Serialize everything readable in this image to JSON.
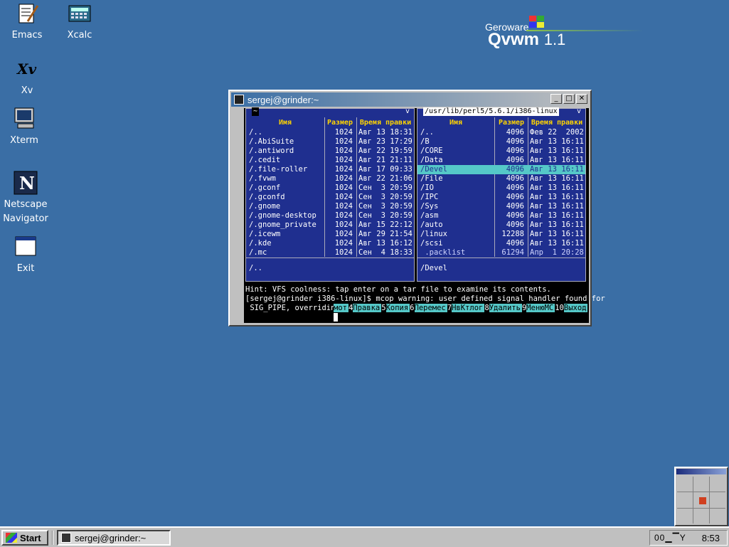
{
  "desktop": {
    "icons": [
      {
        "label": "Emacs"
      },
      {
        "label": "Xcalc"
      },
      {
        "label": "Xv"
      },
      {
        "label": "Xterm"
      },
      {
        "label": "Netscape\nNavigator"
      },
      {
        "label": "Exit"
      }
    ],
    "logo": {
      "brand": "Geroware",
      "product": "Qvwm",
      "version": "1.1"
    }
  },
  "window": {
    "title": "sergej@grinder:~",
    "buttons": {
      "minimize": "_",
      "maximize": "□",
      "close": "✕"
    }
  },
  "mc": {
    "left": {
      "title": "~",
      "title_btn": "v",
      "headers": [
        "Имя",
        "Размер",
        "Время правки"
      ],
      "rows": [
        [
          "/..",
          "1024",
          "Авг 13 18:31"
        ],
        [
          "/.AbiSuite",
          "1024",
          "Авг 23 17:29"
        ],
        [
          "/.antiword",
          "1024",
          "Авг 22 19:59"
        ],
        [
          "/.cedit",
          "1024",
          "Авг 21 21:11"
        ],
        [
          "/.file-roller",
          "1024",
          "Авг 17 09:33"
        ],
        [
          "/.fvwm",
          "1024",
          "Авг 22 21:06"
        ],
        [
          "/.gconf",
          "1024",
          "Сен  3 20:59"
        ],
        [
          "/.gconfd",
          "1024",
          "Сен  3 20:59"
        ],
        [
          "/.gnome",
          "1024",
          "Сен  3 20:59"
        ],
        [
          "/.gnome-desktop",
          "1024",
          "Сен  3 20:59"
        ],
        [
          "/.gnome_private",
          "1024",
          "Авг 15 22:12"
        ],
        [
          "/.icewm",
          "1024",
          "Авг 29 21:54"
        ],
        [
          "/.kde",
          "1024",
          "Авг 13 16:12"
        ],
        [
          "/.mc",
          "1024",
          "Сен  4 18:33"
        ]
      ],
      "footer": "/.."
    },
    "right": {
      "title": "/usr/lib/perl5/5.6.1/i386-linux",
      "title_btn": "v",
      "headers": [
        "Имя",
        "Размер",
        "Время правки"
      ],
      "rows": [
        [
          "/..",
          "4096",
          "Фев 22  2002"
        ],
        [
          "/B",
          "4096",
          "Авг 13 16:11"
        ],
        [
          "/CORE",
          "4096",
          "Авг 13 16:11"
        ],
        [
          "/Data",
          "4096",
          "Авг 13 16:11"
        ],
        [
          "/Devel",
          "4096",
          "Авг 13 16:11"
        ],
        [
          "/File",
          "4096",
          "Авг 13 16:11"
        ],
        [
          "/IO",
          "4096",
          "Авг 13 16:11"
        ],
        [
          "/IPC",
          "4096",
          "Авг 13 16:11"
        ],
        [
          "/Sys",
          "4096",
          "Авг 13 16:11"
        ],
        [
          "/asm",
          "4096",
          "Авг 13 16:11"
        ],
        [
          "/auto",
          "4096",
          "Авг 13 16:11"
        ],
        [
          "/linux",
          "12288",
          "Авг 13 16:11"
        ],
        [
          "/scsi",
          "4096",
          "Авг 13 16:11"
        ],
        [
          " .packlist",
          "61294",
          "Апр  1 20:28"
        ]
      ],
      "selected": 4,
      "footer": "/Devel"
    },
    "hint": "Hint: VFS coolness: tap enter on a tar file to examine its contents.",
    "prompt": "[sergej@grinder i386-linux]$ mcop warning: user defined signal handler found for",
    "prompt2": " SIG_PIPE, overriding",
    "fkeys": [
      {
        "n": "",
        "l": "мот"
      },
      {
        "n": "4",
        "l": "Правка"
      },
      {
        "n": " 5",
        "l": "Копия "
      },
      {
        "n": " 6",
        "l": "Перемес"
      },
      {
        "n": "7",
        "l": "НвКтлог"
      },
      {
        "n": "8",
        "l": "Удалить"
      },
      {
        "n": "9",
        "l": "МенюMC"
      },
      {
        "n": " 10",
        "l": "Выход"
      }
    ]
  },
  "taskbar": {
    "start": "Start",
    "task": "sergej@grinder:~",
    "tray_icons": "00▁▔Y",
    "clock": "8:53"
  },
  "colors": {
    "desktop": "#3a6ea5",
    "mc_panel": "#1f2f8f",
    "mc_select": "#55c8c8",
    "mc_header": "#ffd400"
  }
}
